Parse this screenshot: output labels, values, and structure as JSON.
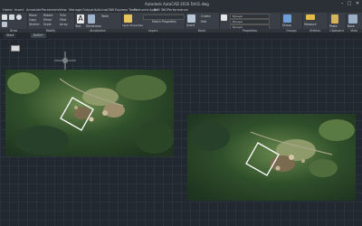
{
  "window": {
    "title": "Autodesk AutoCAD 2016    Drill1.dwg",
    "controls": [
      "minimize",
      "maximize",
      "close"
    ]
  },
  "menu": {
    "items": [
      "Home",
      "Insert",
      "Annotate",
      "Parametric",
      "View",
      "Manage",
      "Output",
      "Add-ins",
      "A360",
      "Express Tools",
      "Featured Apps",
      "BIM 360",
      "Performance"
    ]
  },
  "ribbon": {
    "draw_tools": [
      "Line",
      "Polyline",
      "Circle",
      "Arc"
    ],
    "modify_tools": [
      "Move",
      "Rotate",
      "Trim",
      "Copy",
      "Mirror",
      "Fillet",
      "Stretch",
      "Scale",
      "Array"
    ],
    "panel_titles": [
      "Draw",
      "Modify",
      "Annotation",
      "Layers",
      "Block",
      "Properties",
      "Groups",
      "Utilities",
      "Clipboard",
      "View"
    ],
    "text_tool": "Text",
    "dimension_tool": "Dimension",
    "table_tool": "Table",
    "layer_properties": "Layer Properties",
    "insert_tool": "Insert",
    "create_tool": "Create",
    "edit_tool": "Edit",
    "match_properties": "Match Properties",
    "bylayer_values": [
      "ByLayer",
      "ByLayer",
      "ByLayer"
    ],
    "group_tool": "Group",
    "measure_tool": "Measure",
    "paste_tool": "Paste",
    "base_tool": "Base"
  },
  "doc_tabs": [
    "Start",
    "Drill1*"
  ],
  "accent_colors": {
    "selection_box": "#ffffff",
    "canvas": "#212830",
    "ribbon": "#3a3f47"
  }
}
